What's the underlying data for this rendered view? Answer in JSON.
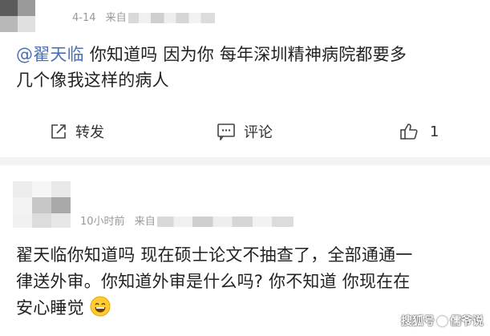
{
  "comment1": {
    "date": "4-14",
    "source_prefix": "来自",
    "mention": "@翟天临",
    "line1_rest": " 你知道吗 因为你 每年深圳精神病院都要多",
    "line2": "几个像我这样的病人"
  },
  "actions": {
    "repost_label": "转发",
    "comment_label": "评论",
    "like_count": "1"
  },
  "comment2": {
    "time": "10小时前",
    "source_prefix": "来自",
    "line1": "翟天临你知道吗 现在硕士论文不抽查了，全部通通一",
    "line2": "律送外审。你知道外审是什么吗? 你不知道 你现在在",
    "line3": "安心睡觉",
    "emoji": "grinning-face"
  },
  "watermark": {
    "brand": "搜狐号",
    "author": "儒爷说"
  },
  "colors": {
    "mention": "#4a6fb5",
    "meta_text": "#999999",
    "separator": "#f3f3f3"
  }
}
